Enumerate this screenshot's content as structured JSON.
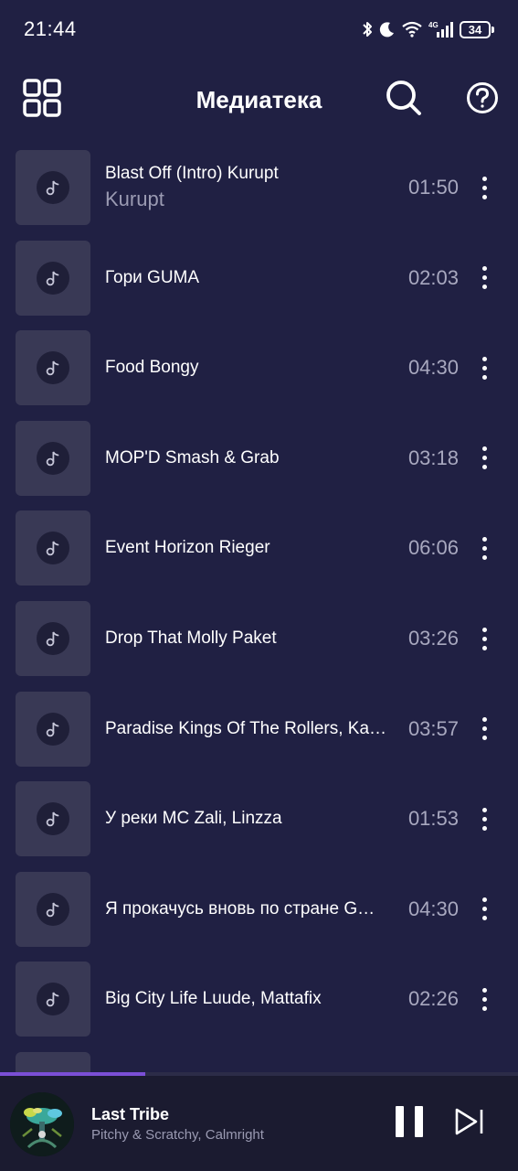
{
  "status_bar": {
    "time": "21:44",
    "battery": "34",
    "network": "4G"
  },
  "header": {
    "title": "Медиатека",
    "icons": [
      "grid-icon",
      "search-icon",
      "help-icon"
    ]
  },
  "tracks": [
    {
      "title": "Blast Off (Intro) Kurupt",
      "artist": "Kurupt",
      "duration": "01:50"
    },
    {
      "title": "Гори GUMA",
      "duration": "02:03"
    },
    {
      "title": "Food Bongy",
      "duration": "04:30"
    },
    {
      "title": "MOP'D Smash & Grab",
      "duration": "03:18"
    },
    {
      "title": "Event Horizon Rieger",
      "duration": "06:06"
    },
    {
      "title": "Drop That Molly Paket",
      "duration": "03:26"
    },
    {
      "title": "Paradise Kings Of The Rollers, Ka…",
      "duration": "03:57"
    },
    {
      "title": "У реки MC Zali, Linzza",
      "duration": "01:53"
    },
    {
      "title": "Я прокачусь вновь по стране G…",
      "duration": "04:30"
    },
    {
      "title": "Big City Life Luude, Mattafix",
      "duration": "02:26"
    }
  ],
  "now_playing": {
    "title": "Last Tribe",
    "artist": "Pitchy & Scratchy, Calmright",
    "progress": 0.28
  },
  "colors": {
    "background": "#202043",
    "player_background": "#1b1b30",
    "cover_placeholder": "#393955",
    "accent": "#7b4fd6",
    "secondary_text": "#9a9ab2"
  }
}
